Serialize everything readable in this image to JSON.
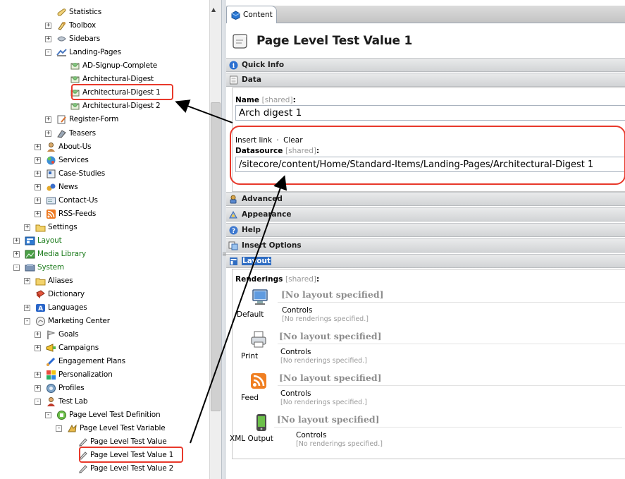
{
  "tree": {
    "items": [
      {
        "label": "Statistics",
        "icon": "statistics-icon",
        "expander": "none"
      },
      {
        "label": "Toolbox",
        "icon": "toolbox-icon",
        "expander": "+"
      },
      {
        "label": "Sidebars",
        "icon": "sidebars-icon",
        "expander": "+"
      },
      {
        "label": "Landing-Pages",
        "icon": "landing-pages-icon",
        "expander": "-"
      },
      {
        "label": "AD-Signup-Complete",
        "icon": "page-icon",
        "expander": "none"
      },
      {
        "label": "Architectural-Digest",
        "icon": "page-icon",
        "expander": "none"
      },
      {
        "label": "Architectural-Digest 1",
        "icon": "page-icon",
        "expander": "none"
      },
      {
        "label": "Architectural-Digest 2",
        "icon": "page-icon",
        "expander": "none"
      },
      {
        "label": "Register-Form",
        "icon": "form-icon",
        "expander": "+"
      },
      {
        "label": "Teasers",
        "icon": "teasers-icon",
        "expander": "+"
      },
      {
        "label": "About-Us",
        "icon": "person-icon",
        "expander": "+"
      },
      {
        "label": "Services",
        "icon": "services-icon",
        "expander": "+"
      },
      {
        "label": "Case-Studies",
        "icon": "case-studies-icon",
        "expander": "+"
      },
      {
        "label": "News",
        "icon": "news-icon",
        "expander": "+"
      },
      {
        "label": "Contact-Us",
        "icon": "contact-icon",
        "expander": "+"
      },
      {
        "label": "RSS-Feeds",
        "icon": "rss-icon",
        "expander": "+"
      },
      {
        "label": "Settings",
        "icon": "folder-icon",
        "expander": "+"
      },
      {
        "label": "Layout",
        "icon": "layout-icon",
        "expander": "+"
      },
      {
        "label": "Media Library",
        "icon": "media-library-icon",
        "expander": "+"
      },
      {
        "label": "System",
        "icon": "system-icon",
        "expander": "-"
      },
      {
        "label": "Aliases",
        "icon": "folder-icon",
        "expander": "+"
      },
      {
        "label": "Dictionary",
        "icon": "dictionary-icon",
        "expander": "none"
      },
      {
        "label": "Languages",
        "icon": "languages-icon",
        "expander": "+"
      },
      {
        "label": "Marketing Center",
        "icon": "marketing-center-icon",
        "expander": "-"
      },
      {
        "label": "Goals",
        "icon": "goals-icon",
        "expander": "+"
      },
      {
        "label": "Campaigns",
        "icon": "campaigns-icon",
        "expander": "+"
      },
      {
        "label": "Engagement Plans",
        "icon": "engagement-plans-icon",
        "expander": "none"
      },
      {
        "label": "Personalization",
        "icon": "personalization-icon",
        "expander": "+"
      },
      {
        "label": "Profiles",
        "icon": "profiles-icon",
        "expander": "+"
      },
      {
        "label": "Test Lab",
        "icon": "test-lab-icon",
        "expander": "-"
      },
      {
        "label": "Page Level Test Definition",
        "icon": "test-definition-icon",
        "expander": "-"
      },
      {
        "label": "Page Level Test Variable",
        "icon": "test-variable-icon",
        "expander": "-"
      },
      {
        "label": "Page Level Test Value",
        "icon": "test-value-icon",
        "expander": "none"
      },
      {
        "label": "Page Level Test Value 1",
        "icon": "test-value-icon",
        "expander": "none"
      },
      {
        "label": "Page Level Test Value 2",
        "icon": "test-value-icon",
        "expander": "none"
      }
    ]
  },
  "content": {
    "tab_label": "Content",
    "title": "Page Level Test Value 1",
    "sections": {
      "quick_info": "Quick Info",
      "data": "Data",
      "advanced": "Advanced",
      "appearance": "Appearance",
      "help": "Help",
      "insert_options": "Insert Options",
      "layout": "Layout"
    },
    "fields": {
      "name_label": "Name",
      "name_shared": "[shared]",
      "name_value": "Arch digest 1",
      "insert_link": "Insert link",
      "dot": "·",
      "clear": "Clear",
      "datasource_label": "Datasource",
      "datasource_shared": "[shared]",
      "datasource_value": "/sitecore/content/Home/Standard-Items/Landing-Pages/Architectural-Digest 1",
      "colon": ":"
    },
    "renderings": {
      "label": "Renderings",
      "shared": "[shared]",
      "devices": [
        {
          "name": "Default",
          "icon": "monitor-icon",
          "layout": "[No layout specified]",
          "controls": "Controls",
          "note": "[No renderings specified.]"
        },
        {
          "name": "Print",
          "icon": "printer-icon",
          "layout": "[No layout specified]",
          "controls": "Controls",
          "note": "[No renderings specified.]"
        },
        {
          "name": "Feed",
          "icon": "feed-icon",
          "layout": "[No layout specified]",
          "controls": "Controls",
          "note": "[No renderings specified.]"
        },
        {
          "name": "XML Output",
          "icon": "phone-icon",
          "layout": "[No layout specified]",
          "controls": "Controls",
          "note": "[No renderings specified.]"
        }
      ]
    }
  }
}
